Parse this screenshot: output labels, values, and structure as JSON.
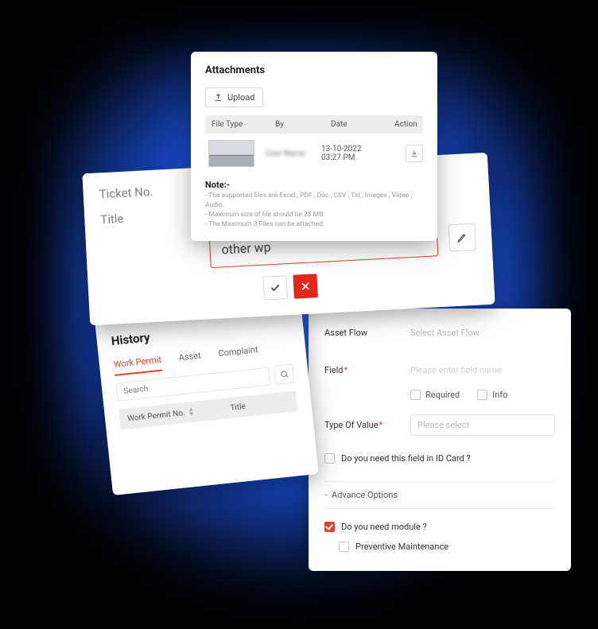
{
  "attachments": {
    "title": "Attachments",
    "upload_label": "Upload",
    "columns": {
      "file_type": "File Type",
      "by": "By",
      "date": "Date",
      "action": "Action"
    },
    "row": {
      "by": "User Name",
      "date_line1": "13-10-2022",
      "date_line2": "03:27 PM"
    },
    "note_heading": "Note:-",
    "notes": [
      "The supported files are Excel , PDF , Doc , CSV , Txt , Images , Video , Audio.",
      "Maximum size of file should be 25 MB.",
      "The Maximum 3 Files can be attached."
    ]
  },
  "ticket": {
    "ticket_no_label": "Ticket No.",
    "title_label": "Title",
    "title_value": "other wp"
  },
  "history": {
    "title": "History",
    "tabs": {
      "work_permit": "Work Permit",
      "asset": "Asset",
      "complaint": "Complaint"
    },
    "search_placeholder": "Search",
    "columns": {
      "wp_no": "Work Permit No.",
      "title": "Title"
    }
  },
  "form": {
    "asset_flow_label": "Asset Flow",
    "asset_flow_placeholder": "Select Asset Flow",
    "field_label": "Field",
    "field_placeholder": "Please enter field name",
    "required_label": "Required",
    "info_label": "Info",
    "type_label": "Type Of Value",
    "type_placeholder": "Please select",
    "id_card_question": "Do you need this field in ID Card ?",
    "advance_label": "Advance Options",
    "module_question": "Do you need module ?",
    "pm_label": "Preventive Maintenance"
  }
}
